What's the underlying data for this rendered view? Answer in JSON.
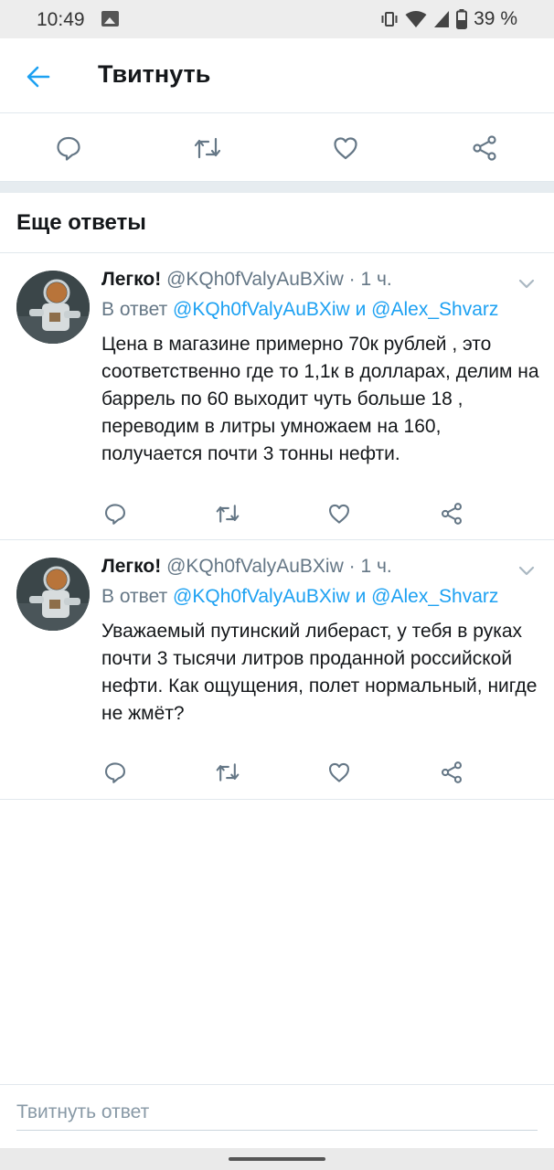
{
  "status_bar": {
    "time": "10:49",
    "battery_text": "39 %",
    "icons": [
      "image-icon",
      "vibrate-icon",
      "wifi-icon",
      "signal-icon",
      "battery-icon"
    ]
  },
  "app_bar": {
    "title": "Твитнуть",
    "back_icon": "arrow-left-icon",
    "accent_color": "#1da1f2"
  },
  "main_actions": {
    "icons": [
      "reply-icon",
      "retweet-icon",
      "like-icon",
      "share-icon"
    ]
  },
  "section": {
    "title": "Еще ответы"
  },
  "tweets": [
    {
      "name": "Легко!",
      "handle": "@KQh0fValyAuBXiw",
      "separator": "·",
      "time": "1 ч.",
      "reply_prefix": "В ответ",
      "reply_user1": "@KQh0fValyAuBXiw",
      "reply_and": "и",
      "reply_user2": "@Alex_Shvarz",
      "text": "Цена в магазине примерно 70к рублей , это соответственно где то 1,1к в долларах, делим на баррель по 60 выходит чуть больше 18 , переводим в литры умножаем на  160, получается почти 3 тонны нефти."
    },
    {
      "name": "Легко!",
      "handle": "@KQh0fValyAuBXiw",
      "separator": "·",
      "time": "1 ч.",
      "reply_prefix": "В ответ",
      "reply_user1": "@KQh0fValyAuBXiw",
      "reply_and": "и",
      "reply_user2": "@Alex_Shvarz",
      "text": "Уважаемый путинский либераст,  у тебя в руках почти 3 тысячи литров проданной российской нефти. Как ощущения, полет нормальный, нигде не жмёт?"
    }
  ],
  "reply_bar": {
    "placeholder": "Твитнуть ответ",
    "value": ""
  }
}
